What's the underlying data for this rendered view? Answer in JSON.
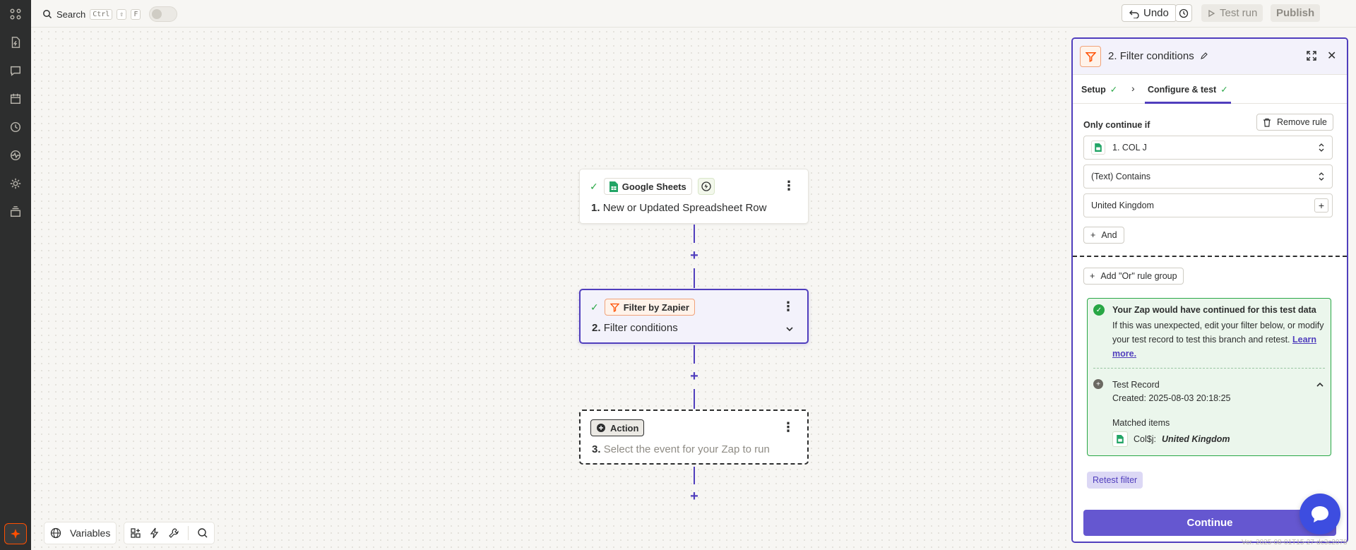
{
  "topbar": {
    "search_label": "Search",
    "shortcut": [
      "Ctrl",
      "⇧",
      "F"
    ],
    "undo_label": "Undo",
    "test_run_label": "Test run",
    "publish_label": "Publish"
  },
  "rail": {
    "icons": [
      "apps-icon",
      "zap-file-icon",
      "chat-icon",
      "calendar-icon",
      "history-icon",
      "activity-icon",
      "settings-icon",
      "stack-icon"
    ],
    "copilot": "copilot-icon"
  },
  "nodes": [
    {
      "app": "Google Sheets",
      "number": "1.",
      "title": "New or Updated Spreadsheet Row",
      "status": "complete"
    },
    {
      "app": "Filter by Zapier",
      "number": "2.",
      "title": "Filter conditions",
      "status": "complete"
    },
    {
      "app": "Action",
      "number": "3.",
      "title": "Select the event for your Zap to run",
      "status": "placeholder"
    }
  ],
  "bottombar": {
    "variables_label": "Variables"
  },
  "panel": {
    "number": "2.",
    "title": "Filter conditions",
    "tabs": [
      {
        "label": "Setup",
        "complete": true
      },
      {
        "label": "Configure & test",
        "complete": true
      }
    ],
    "rule_heading": "Only continue if",
    "remove_rule_label": "Remove rule",
    "field_label": "1. COL J",
    "condition": "(Text) Contains",
    "value": "United Kingdom",
    "and_label": "And",
    "or_label": "Add \"Or\" rule group",
    "result": {
      "title": "Your Zap would have continued for this test data",
      "text": "If this was unexpected, edit your filter below, or modify your test record to test this branch and retest.",
      "link": "Learn more.",
      "record_title": "Test Record",
      "created": "Created: 2025-08-03 20:18:25",
      "matched_heading": "Matched items",
      "matched_key": "Col$j:",
      "matched_value": "United Kingdom"
    },
    "retest_label": "Retest filter",
    "continue_label": "Continue"
  },
  "version": "Ver. 2025-08-01T15-27-dc3c2078",
  "colors": {
    "accent": "#503ebd",
    "brand_orange": "#ff4f00",
    "success": "#28a745",
    "rail_bg": "#2d2e2e"
  }
}
